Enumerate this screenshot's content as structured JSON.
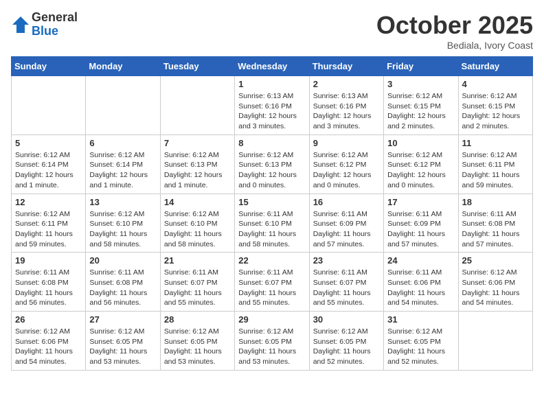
{
  "logo": {
    "general": "General",
    "blue": "Blue"
  },
  "header": {
    "month": "October 2025",
    "location": "Bediala, Ivory Coast"
  },
  "weekdays": [
    "Sunday",
    "Monday",
    "Tuesday",
    "Wednesday",
    "Thursday",
    "Friday",
    "Saturday"
  ],
  "weeks": [
    [
      {
        "day": "",
        "info": ""
      },
      {
        "day": "",
        "info": ""
      },
      {
        "day": "",
        "info": ""
      },
      {
        "day": "1",
        "info": "Sunrise: 6:13 AM\nSunset: 6:16 PM\nDaylight: 12 hours\nand 3 minutes."
      },
      {
        "day": "2",
        "info": "Sunrise: 6:13 AM\nSunset: 6:16 PM\nDaylight: 12 hours\nand 3 minutes."
      },
      {
        "day": "3",
        "info": "Sunrise: 6:12 AM\nSunset: 6:15 PM\nDaylight: 12 hours\nand 2 minutes."
      },
      {
        "day": "4",
        "info": "Sunrise: 6:12 AM\nSunset: 6:15 PM\nDaylight: 12 hours\nand 2 minutes."
      }
    ],
    [
      {
        "day": "5",
        "info": "Sunrise: 6:12 AM\nSunset: 6:14 PM\nDaylight: 12 hours\nand 1 minute."
      },
      {
        "day": "6",
        "info": "Sunrise: 6:12 AM\nSunset: 6:14 PM\nDaylight: 12 hours\nand 1 minute."
      },
      {
        "day": "7",
        "info": "Sunrise: 6:12 AM\nSunset: 6:13 PM\nDaylight: 12 hours\nand 1 minute."
      },
      {
        "day": "8",
        "info": "Sunrise: 6:12 AM\nSunset: 6:13 PM\nDaylight: 12 hours\nand 0 minutes."
      },
      {
        "day": "9",
        "info": "Sunrise: 6:12 AM\nSunset: 6:12 PM\nDaylight: 12 hours\nand 0 minutes."
      },
      {
        "day": "10",
        "info": "Sunrise: 6:12 AM\nSunset: 6:12 PM\nDaylight: 12 hours\nand 0 minutes."
      },
      {
        "day": "11",
        "info": "Sunrise: 6:12 AM\nSunset: 6:11 PM\nDaylight: 11 hours\nand 59 minutes."
      }
    ],
    [
      {
        "day": "12",
        "info": "Sunrise: 6:12 AM\nSunset: 6:11 PM\nDaylight: 11 hours\nand 59 minutes."
      },
      {
        "day": "13",
        "info": "Sunrise: 6:12 AM\nSunset: 6:10 PM\nDaylight: 11 hours\nand 58 minutes."
      },
      {
        "day": "14",
        "info": "Sunrise: 6:12 AM\nSunset: 6:10 PM\nDaylight: 11 hours\nand 58 minutes."
      },
      {
        "day": "15",
        "info": "Sunrise: 6:11 AM\nSunset: 6:10 PM\nDaylight: 11 hours\nand 58 minutes."
      },
      {
        "day": "16",
        "info": "Sunrise: 6:11 AM\nSunset: 6:09 PM\nDaylight: 11 hours\nand 57 minutes."
      },
      {
        "day": "17",
        "info": "Sunrise: 6:11 AM\nSunset: 6:09 PM\nDaylight: 11 hours\nand 57 minutes."
      },
      {
        "day": "18",
        "info": "Sunrise: 6:11 AM\nSunset: 6:08 PM\nDaylight: 11 hours\nand 57 minutes."
      }
    ],
    [
      {
        "day": "19",
        "info": "Sunrise: 6:11 AM\nSunset: 6:08 PM\nDaylight: 11 hours\nand 56 minutes."
      },
      {
        "day": "20",
        "info": "Sunrise: 6:11 AM\nSunset: 6:08 PM\nDaylight: 11 hours\nand 56 minutes."
      },
      {
        "day": "21",
        "info": "Sunrise: 6:11 AM\nSunset: 6:07 PM\nDaylight: 11 hours\nand 55 minutes."
      },
      {
        "day": "22",
        "info": "Sunrise: 6:11 AM\nSunset: 6:07 PM\nDaylight: 11 hours\nand 55 minutes."
      },
      {
        "day": "23",
        "info": "Sunrise: 6:11 AM\nSunset: 6:07 PM\nDaylight: 11 hours\nand 55 minutes."
      },
      {
        "day": "24",
        "info": "Sunrise: 6:11 AM\nSunset: 6:06 PM\nDaylight: 11 hours\nand 54 minutes."
      },
      {
        "day": "25",
        "info": "Sunrise: 6:12 AM\nSunset: 6:06 PM\nDaylight: 11 hours\nand 54 minutes."
      }
    ],
    [
      {
        "day": "26",
        "info": "Sunrise: 6:12 AM\nSunset: 6:06 PM\nDaylight: 11 hours\nand 54 minutes."
      },
      {
        "day": "27",
        "info": "Sunrise: 6:12 AM\nSunset: 6:05 PM\nDaylight: 11 hours\nand 53 minutes."
      },
      {
        "day": "28",
        "info": "Sunrise: 6:12 AM\nSunset: 6:05 PM\nDaylight: 11 hours\nand 53 minutes."
      },
      {
        "day": "29",
        "info": "Sunrise: 6:12 AM\nSunset: 6:05 PM\nDaylight: 11 hours\nand 53 minutes."
      },
      {
        "day": "30",
        "info": "Sunrise: 6:12 AM\nSunset: 6:05 PM\nDaylight: 11 hours\nand 52 minutes."
      },
      {
        "day": "31",
        "info": "Sunrise: 6:12 AM\nSunset: 6:05 PM\nDaylight: 11 hours\nand 52 minutes."
      },
      {
        "day": "",
        "info": ""
      }
    ]
  ]
}
